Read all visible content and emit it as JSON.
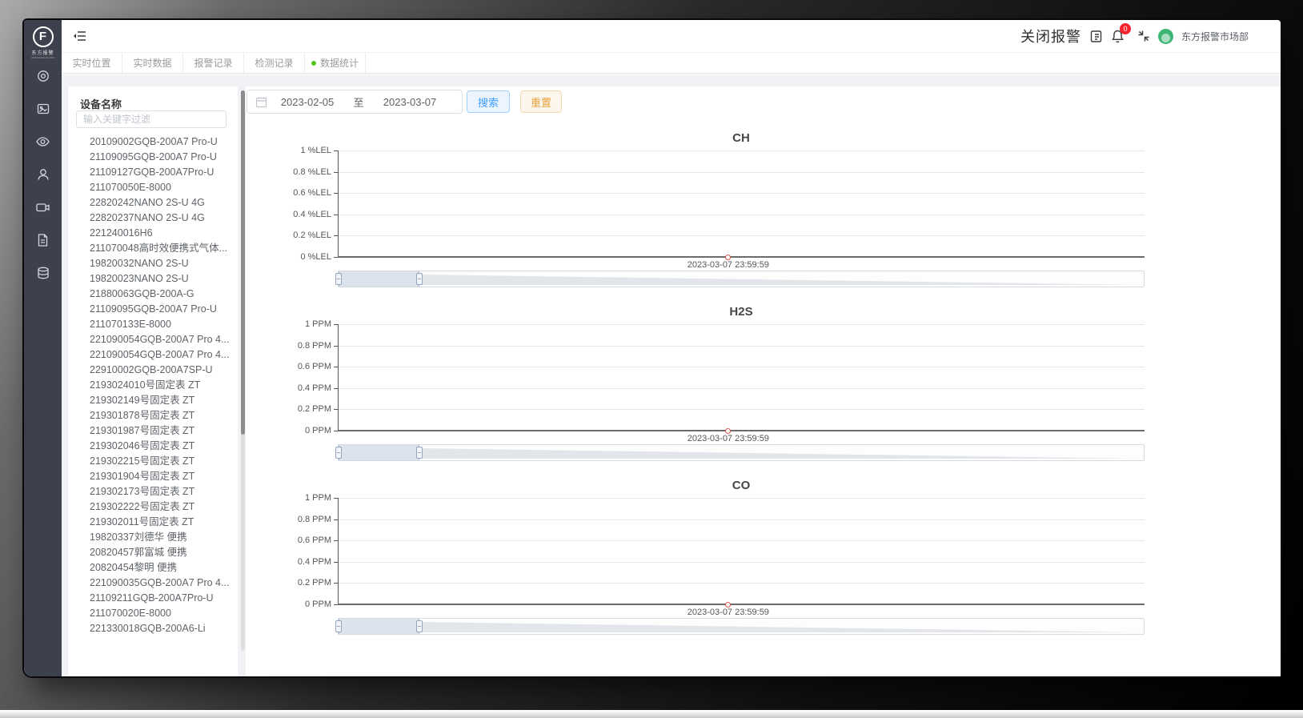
{
  "app": {
    "logo_letter": "F",
    "logo_text": "东方报警",
    "close_alarm_label": "关闭报警",
    "notification_badge": "0",
    "user_name": "东方报警市场部"
  },
  "tabs": [
    {
      "label": "实时位置",
      "active": false
    },
    {
      "label": "实时数据",
      "active": false
    },
    {
      "label": "报警记录",
      "active": false
    },
    {
      "label": "检测记录",
      "active": false
    },
    {
      "label": "数据统计",
      "active": true
    }
  ],
  "sidebar_icons": [
    "target-icon",
    "image-icon",
    "eye-icon",
    "user-icon",
    "video-icon",
    "document-icon",
    "database-icon"
  ],
  "device_panel": {
    "title": "设备名称",
    "filter_placeholder": "输入关键字过滤",
    "devices": [
      "20109002GQB-200A7 Pro-U",
      "21109095GQB-200A7 Pro-U",
      "21109127GQB-200A7Pro-U",
      "211070050E-8000",
      "22820242NANO 2S-U 4G",
      "22820237NANO 2S-U 4G",
      "221240016H6",
      "211070048高时效便携式气体...",
      "19820032NANO 2S-U",
      "19820023NANO 2S-U",
      "21880063GQB-200A-G",
      "21109095GQB-200A7 Pro-U",
      "211070133E-8000",
      "221090054GQB-200A7 Pro 4...",
      "221090054GQB-200A7 Pro 4...",
      "22910002GQB-200A7SP-U",
      "2193024010号固定表 ZT",
      "219302149号固定表 ZT",
      "219301878号固定表 ZT",
      "219301987号固定表 ZT",
      "219302046号固定表 ZT",
      "219302215号固定表 ZT",
      "219301904号固定表 ZT",
      "219302173号固定表 ZT",
      "219302222号固定表 ZT",
      "219302011号固定表 ZT",
      "19820337刘德华 便携",
      "20820457郭富城 便携",
      "20820454黎明 便携",
      "221090035GQB-200A7 Pro 4...",
      "21109211GQB-200A7Pro-U",
      "211070020E-8000",
      "221330018GQB-200A6-Li"
    ]
  },
  "toolbar": {
    "start_date": "2023-02-05",
    "range_separator": "至",
    "end_date": "2023-03-07",
    "search_label": "搜索",
    "reset_label": "重置"
  },
  "chart_data": [
    {
      "type": "line",
      "title": "CH",
      "ylabel": "%LEL",
      "xlabel": "",
      "ylim": [
        0,
        1
      ],
      "y_ticks": [
        "1 %LEL",
        "0.8 %LEL",
        "0.6 %LEL",
        "0.4 %LEL",
        "0.2 %LEL",
        "0 %LEL"
      ],
      "x": [
        "2023-03-07 23:59:59"
      ],
      "series": [
        {
          "name": "CH",
          "values": [
            0
          ]
        }
      ],
      "grid": true,
      "legend": false,
      "zoom_window": [
        0,
        10
      ]
    },
    {
      "type": "line",
      "title": "H2S",
      "ylabel": "PPM",
      "xlabel": "",
      "ylim": [
        0,
        1
      ],
      "y_ticks": [
        "1 PPM",
        "0.8 PPM",
        "0.6 PPM",
        "0.4 PPM",
        "0.2 PPM",
        "0 PPM"
      ],
      "x": [
        "2023-03-07 23:59:59"
      ],
      "series": [
        {
          "name": "H2S",
          "values": [
            0
          ]
        }
      ],
      "grid": true,
      "legend": false,
      "zoom_window": [
        0,
        10
      ]
    },
    {
      "type": "line",
      "title": "CO",
      "ylabel": "PPM",
      "xlabel": "",
      "ylim": [
        0,
        1
      ],
      "y_ticks": [
        "1 PPM",
        "0.8 PPM",
        "0.6 PPM",
        "0.4 PPM",
        "0.2 PPM",
        "0 PPM"
      ],
      "x": [
        "2023-03-07 23:59:59"
      ],
      "series": [
        {
          "name": "CO",
          "values": [
            0
          ]
        }
      ],
      "grid": true,
      "legend": false,
      "zoom_window": [
        0,
        10
      ]
    }
  ],
  "colors": {
    "sidebar_bg": "#3c414d",
    "content_bg": "#f0f2f5",
    "accent_blue": "#409eff",
    "accent_orange": "#e6a23c",
    "active_tab_green": "#52c41a",
    "badge_red": "#f5222d",
    "point_red": "#d6574e"
  }
}
